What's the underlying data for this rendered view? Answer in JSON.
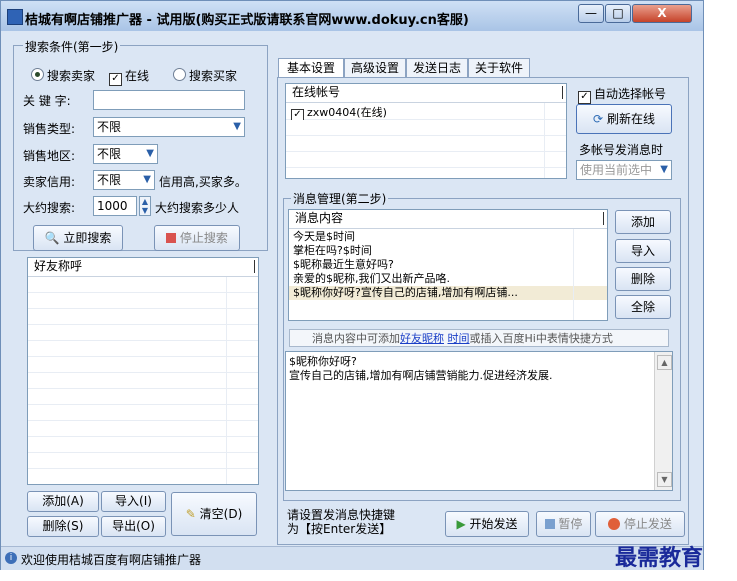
{
  "window": {
    "title": "桔城有啊店铺推广器 - 试用版(购买正式版请联系官网www.dokuy.cn客服)",
    "min_label": "—",
    "max_label": "□",
    "close_label": "X"
  },
  "search": {
    "legend": "搜索条件(第一步)",
    "radio_seller": "搜索卖家",
    "check_online": "在线",
    "radio_buyer": "搜索买家",
    "keyword_label": "关 键 字:",
    "keyword_value": "",
    "sale_type_label": "销售类型:",
    "sale_type_value": "不限",
    "region_label": "销售地区:",
    "region_value": "不限",
    "credit_label": "卖家信用:",
    "credit_value": "不限",
    "credit_hint": "信用高,买家多。",
    "approx_label": "大约搜索:",
    "approx_value": "1000",
    "approx_hint": "大约搜索多少人",
    "search_btn": "立即搜索",
    "stop_btn": "停止搜索"
  },
  "friends": {
    "header": "好友称呼",
    "rows": []
  },
  "left_buttons": {
    "add": "添加(A)",
    "import": "导入(I)",
    "delete": "删除(S)",
    "export": "导出(O)",
    "clear": "清空(D)"
  },
  "tabs": [
    "基本设置",
    "高级设置",
    "发送日志",
    "关于软件"
  ],
  "accounts": {
    "header": "在线帐号",
    "items": [
      {
        "label": "zxw0404(在线)",
        "checked": true
      }
    ],
    "auto_select": "自动选择帐号",
    "refresh_btn": "刷新在线",
    "multi_label": "多帐号发消息时",
    "multi_value": "使用当前选中"
  },
  "messages": {
    "legend": "消息管理(第二步)",
    "header": "消息内容",
    "items": [
      "今天是$时间",
      "掌柜在吗?$时间",
      "$昵称最近生意好吗?",
      "亲爱的$昵称,我们又出新产品咯.",
      "$昵称你好呀?宣传自己的店铺,增加有啊店铺..."
    ],
    "add_btn": "添加",
    "import_btn": "导入",
    "delete_btn": "删除",
    "clear_btn": "全除",
    "hint_prefix": "消息内容中可添加",
    "hint_link1": "好友昵称",
    "hint_link2": "时间",
    "hint_suffix": "或插入百度Hi中表情快捷方式",
    "editor_line1": "$昵称你好呀?",
    "editor_line2": "宣传自己的店铺,增加有啊店铺营销能力.促进经济发展."
  },
  "send": {
    "hotkey_line1": "请设置发消息快捷键",
    "hotkey_line2": "为【按Enter发送】",
    "start_btn": "开始发送",
    "pause_btn": "暂停",
    "stop_btn": "停止发送"
  },
  "status": {
    "text": "欢迎使用桔城百度有啊店铺推广器"
  },
  "watermark": "最需教育"
}
